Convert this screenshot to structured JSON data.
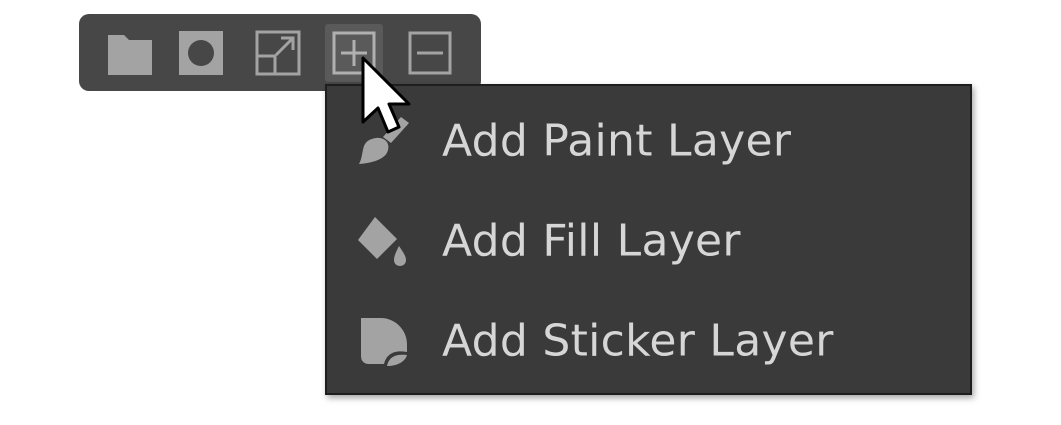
{
  "toolbar": {
    "buttons": [
      {
        "icon": "folder-icon"
      },
      {
        "icon": "circle-mask-icon"
      },
      {
        "icon": "resize-icon"
      },
      {
        "icon": "plus-box-icon",
        "active": true
      },
      {
        "icon": "minus-box-icon"
      }
    ]
  },
  "menu": {
    "items": [
      {
        "label": "Add Paint Layer",
        "icon": "paint-brush-icon"
      },
      {
        "label": "Add Fill Layer",
        "icon": "paint-bucket-icon"
      },
      {
        "label": "Add Sticker Layer",
        "icon": "sticker-icon"
      }
    ]
  },
  "colors": {
    "toolbar_bg": "#474747",
    "menu_bg": "#3a3a3a",
    "icon": "#a3a3a3",
    "text": "#d6d6d6"
  }
}
